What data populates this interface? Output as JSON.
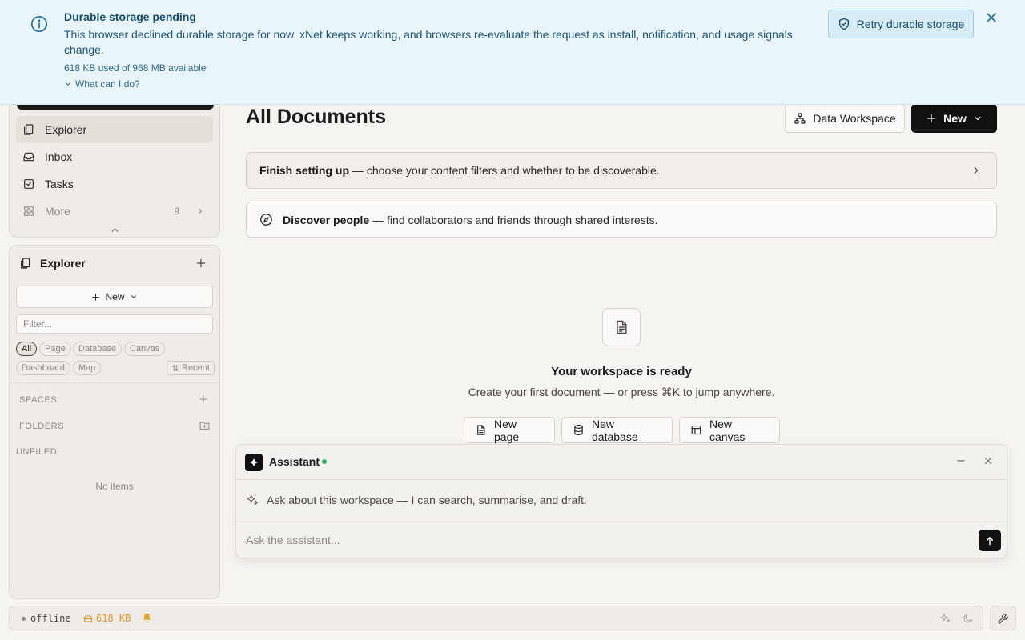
{
  "banner": {
    "title": "Durable storage pending",
    "message": "This browser declined durable storage for now. xNet keeps working, and browsers re-evaluate the request as install, notification, and usage signals change.",
    "usage": "618 KB used of 968 MB available",
    "help_link": "What can I do?",
    "retry_label": "Retry durable storage",
    "accent_color": "#1f6f9f"
  },
  "nav": {
    "items": [
      {
        "label": "Explorer",
        "icon": "file-stack-icon",
        "active": true
      },
      {
        "label": "Inbox",
        "icon": "inbox-icon"
      },
      {
        "label": "Tasks",
        "icon": "checkbox-icon"
      },
      {
        "label": "More",
        "icon": "grid-icon",
        "count": "9"
      }
    ]
  },
  "explorer": {
    "title": "Explorer",
    "new_label": "New",
    "filter_placeholder": "Filter...",
    "chips": [
      "All",
      "Page",
      "Database",
      "Canvas",
      "Dashboard",
      "Map"
    ],
    "sort_label": "Recent",
    "sections": {
      "spaces": "SPACES",
      "folders": "FOLDERS",
      "unfiled": "UNFILED"
    },
    "empty": "No items"
  },
  "main": {
    "title": "All Documents",
    "data_workspace_label": "Data Workspace",
    "new_label": "New",
    "setup": {
      "bold": "Finish setting up",
      "text": "— choose your content filters and whether to be discoverable."
    },
    "discover": {
      "bold": "Discover people",
      "text": "— find collaborators and friends through shared interests."
    },
    "empty_state": {
      "title": "Your workspace is ready",
      "subtitle": "Create your first document — or press ⌘K to jump anywhere.",
      "buttons": [
        "New page",
        "New database",
        "New canvas"
      ]
    }
  },
  "assistant": {
    "title": "Assistant",
    "status_color": "#2fb45a",
    "hint": "Ask about this workspace — I can search, summarise, and draft.",
    "input_placeholder": "Ask the assistant..."
  },
  "statusbar": {
    "connection": "offline",
    "storage": "618 KB",
    "storage_color": "#e3932a"
  }
}
